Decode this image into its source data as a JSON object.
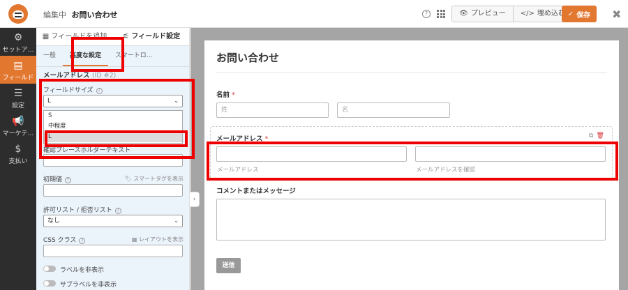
{
  "header": {
    "editing_prefix": "編集中",
    "form_name": "お問い合わせ",
    "help_label": "?",
    "preview_label": "プレビュー",
    "embed_label": "埋め込む",
    "save_label": "保存",
    "close_label": "✖",
    "accent": "#e27730"
  },
  "leftnav": {
    "items": [
      {
        "label": "セットア…",
        "icon": "gear-icon"
      },
      {
        "label": "フィールド",
        "icon": "fields-icon"
      },
      {
        "label": "設定",
        "icon": "sliders-icon"
      },
      {
        "label": "マーケテ…",
        "icon": "megaphone-icon"
      },
      {
        "label": "支払い",
        "icon": "dollar-icon"
      }
    ]
  },
  "sidebar": {
    "tab_add": "フィールドを追加",
    "tab_options": "フィールド設定",
    "sub_tabs": [
      "一般",
      "高度な設定",
      "スマートロ…"
    ],
    "field_title": "メールアドレス",
    "field_id": "(ID #2)",
    "field_size_label": "フィールドサイズ",
    "field_size_value": "L",
    "field_size_options": [
      "S",
      "中程度",
      "L"
    ],
    "confirm_placeholder_label": "確認プレースホルダーテキスト",
    "default_value_label": "初期値",
    "smart_tags_label": "スマートタグを表示",
    "allow_deny_label": "許可リスト / 拒否リスト",
    "allow_deny_value": "なし",
    "css_class_label": "CSS クラス",
    "layouts_label": "レイアウトを表示",
    "hide_label": "ラベルを非表示",
    "hide_sublabel": "サブラベルを非表示"
  },
  "preview": {
    "form_title": "お問い合わせ",
    "name_label": "名前",
    "required_mark": "*",
    "first_placeholder": "姓",
    "last_placeholder": "名",
    "email_label": "メールアドレス",
    "email_sub": "メールアドレス",
    "email_confirm_sub": "メールアドレスを確認",
    "message_label": "コメントまたはメッセージ",
    "submit_label": "送信"
  }
}
